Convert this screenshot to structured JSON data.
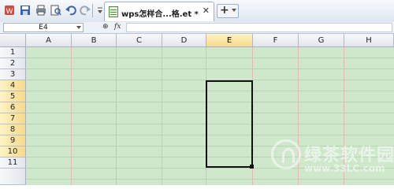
{
  "toolbar": {
    "icons": [
      "app-logo-icon",
      "save-icon",
      "print-icon",
      "print-preview-icon",
      "undo-icon",
      "redo-icon",
      "customize-icon"
    ],
    "tab": {
      "title": "wps怎样合...格.et *",
      "close": "✕"
    },
    "new_tab": "+"
  },
  "formula_bar": {
    "name_box": "E4",
    "zoom_icon": "⊕",
    "fx": "fx",
    "formula": ""
  },
  "grid": {
    "columns": [
      "A",
      "B",
      "C",
      "D",
      "E",
      "F",
      "G",
      "H"
    ],
    "rows": [
      "1",
      "2",
      "3",
      "4",
      "5",
      "6",
      "7",
      "8",
      "9",
      "10",
      "11"
    ],
    "active_column": "E",
    "selected_rows": [
      "4",
      "5",
      "6",
      "7",
      "8",
      "9",
      "10"
    ],
    "selection_range": "E4:E10",
    "background_color": "#cfe8cc"
  },
  "watermark": {
    "brand": "绿茶软件园",
    "url": "www.33LC.com"
  }
}
